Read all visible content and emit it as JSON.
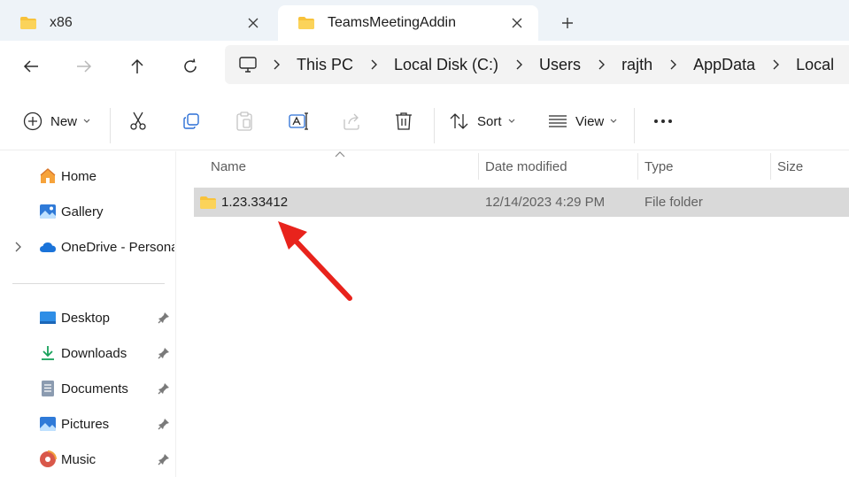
{
  "tabs": [
    {
      "title": "x86",
      "active": false
    },
    {
      "title": "TeamsMeetingAddin",
      "active": true
    }
  ],
  "breadcrumb": [
    "This PC",
    "Local Disk (C:)",
    "Users",
    "rajth",
    "AppData",
    "Local"
  ],
  "commands": {
    "new_label": "New",
    "sort_label": "Sort",
    "view_label": "View"
  },
  "nav": {
    "items": [
      {
        "label": "Home",
        "icon": "home-icon"
      },
      {
        "label": "Gallery",
        "icon": "gallery-icon"
      },
      {
        "label": "OneDrive - Personal",
        "icon": "cloud-icon"
      },
      {
        "label": "Desktop",
        "icon": "desktop-icon",
        "pinned": true
      },
      {
        "label": "Downloads",
        "icon": "download-icon",
        "pinned": true
      },
      {
        "label": "Documents",
        "icon": "document-icon",
        "pinned": true
      },
      {
        "label": "Pictures",
        "icon": "pictures-icon",
        "pinned": true
      },
      {
        "label": "Music",
        "icon": "music-icon",
        "pinned": true
      }
    ]
  },
  "columns": [
    "Name",
    "Date modified",
    "Type",
    "Size"
  ],
  "files": [
    {
      "name": "1.23.33412",
      "date_modified": "12/14/2023 4:29 PM",
      "type": "File folder",
      "size": ""
    }
  ],
  "colors": {
    "accent": "#0067c0",
    "folder": "#f8c23a",
    "selection": "#d9d9d9",
    "annotation_arrow": "#e8231c"
  }
}
